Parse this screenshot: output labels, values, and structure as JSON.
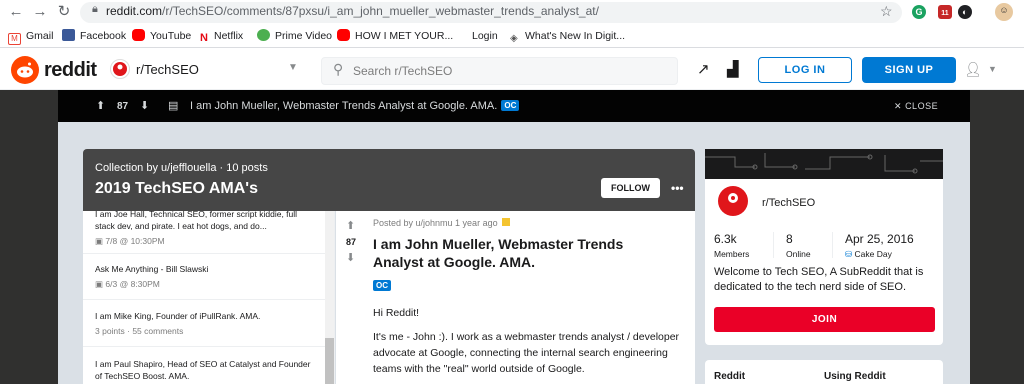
{
  "browser": {
    "url_domain": "reddit.com",
    "url_path": "/r/TechSEO/comments/87pxsu/i_am_john_mueller_webmaster_trends_analyst_at/",
    "extension_badge": "11",
    "bookmarks": [
      {
        "label": "Gmail",
        "icon": "gmail-icon",
        "color": "#ea4335"
      },
      {
        "label": "Facebook",
        "icon": "facebook-icon",
        "color": "#3b5998"
      },
      {
        "label": "YouTube",
        "icon": "youtube-icon",
        "color": "#ff0000"
      },
      {
        "label": "Netflix",
        "icon": "netflix-icon",
        "color": "#e50914"
      },
      {
        "label": "Prime Video",
        "icon": "prime-video-icon",
        "color": "#00a8e1"
      },
      {
        "label": "HOW I MET YOUR...",
        "icon": "youtube-icon",
        "color": "#ff0000"
      },
      {
        "label": "Login",
        "icon": "blank-icon",
        "color": "#ffffff"
      },
      {
        "label": "What's New In Digit...",
        "icon": "page-icon",
        "color": "#555555"
      }
    ]
  },
  "header": {
    "logo_text": "reddit",
    "subreddit": "r/TechSEO",
    "search_placeholder": "Search r/TechSEO",
    "login_label": "LOG IN",
    "signup_label": "SIGN UP",
    "brand_color": "#ff4500",
    "accent_color": "#0079d3"
  },
  "post_bar": {
    "votes": "87",
    "title": "I am John Mueller, Webmaster Trends Analyst at Google. AMA.",
    "flair": "OC",
    "close_label": "CLOSE"
  },
  "collection": {
    "subtitle": "Collection by u/jefflouella · 10 posts",
    "title": "2019 TechSEO AMA's",
    "follow_label": "FOLLOW",
    "items": [
      {
        "title": "I am Joe Hall, Technical SEO, former script kiddie, full stack dev, and pirate. I eat hot dogs, and do...",
        "meta": "7/8 @ 10:30PM"
      },
      {
        "title": "Ask Me Anything - Bill Slawski",
        "meta": "6/3 @ 8:30PM"
      },
      {
        "title": "I am Mike King, Founder of iPullRank. AMA.",
        "meta": "3 points · 55 comments"
      },
      {
        "title": "I am Paul Shapiro, Head of SEO at Catalyst and Founder of TechSEO Boost. AMA.",
        "meta": ""
      }
    ]
  },
  "post": {
    "votes": "87",
    "meta": "Posted by u/johnmu 1 year ago",
    "title": "I am John Mueller, Webmaster Trends Analyst at Google. AMA.",
    "flair": "OC",
    "body_1": "Hi Reddit!",
    "body_2": "It's me - John :). I work as a webmaster trends analyst / developer advocate at Google, connecting the internal search engineering teams with the \"real\" world outside of Google."
  },
  "sidebar": {
    "name": "r/TechSEO",
    "members": "6.3k",
    "members_label": "Members",
    "online": "8",
    "online_label": "Online",
    "cake_date": "Apr 25, 2016",
    "cake_label": "Cake Day",
    "description": "Welcome to Tech SEO, A SubReddit that is dedicated to the tech nerd side of SEO.",
    "join_label": "JOIN",
    "join_color": "#ea0027",
    "footer_col1": "Reddit",
    "footer_col2": "Using Reddit"
  }
}
